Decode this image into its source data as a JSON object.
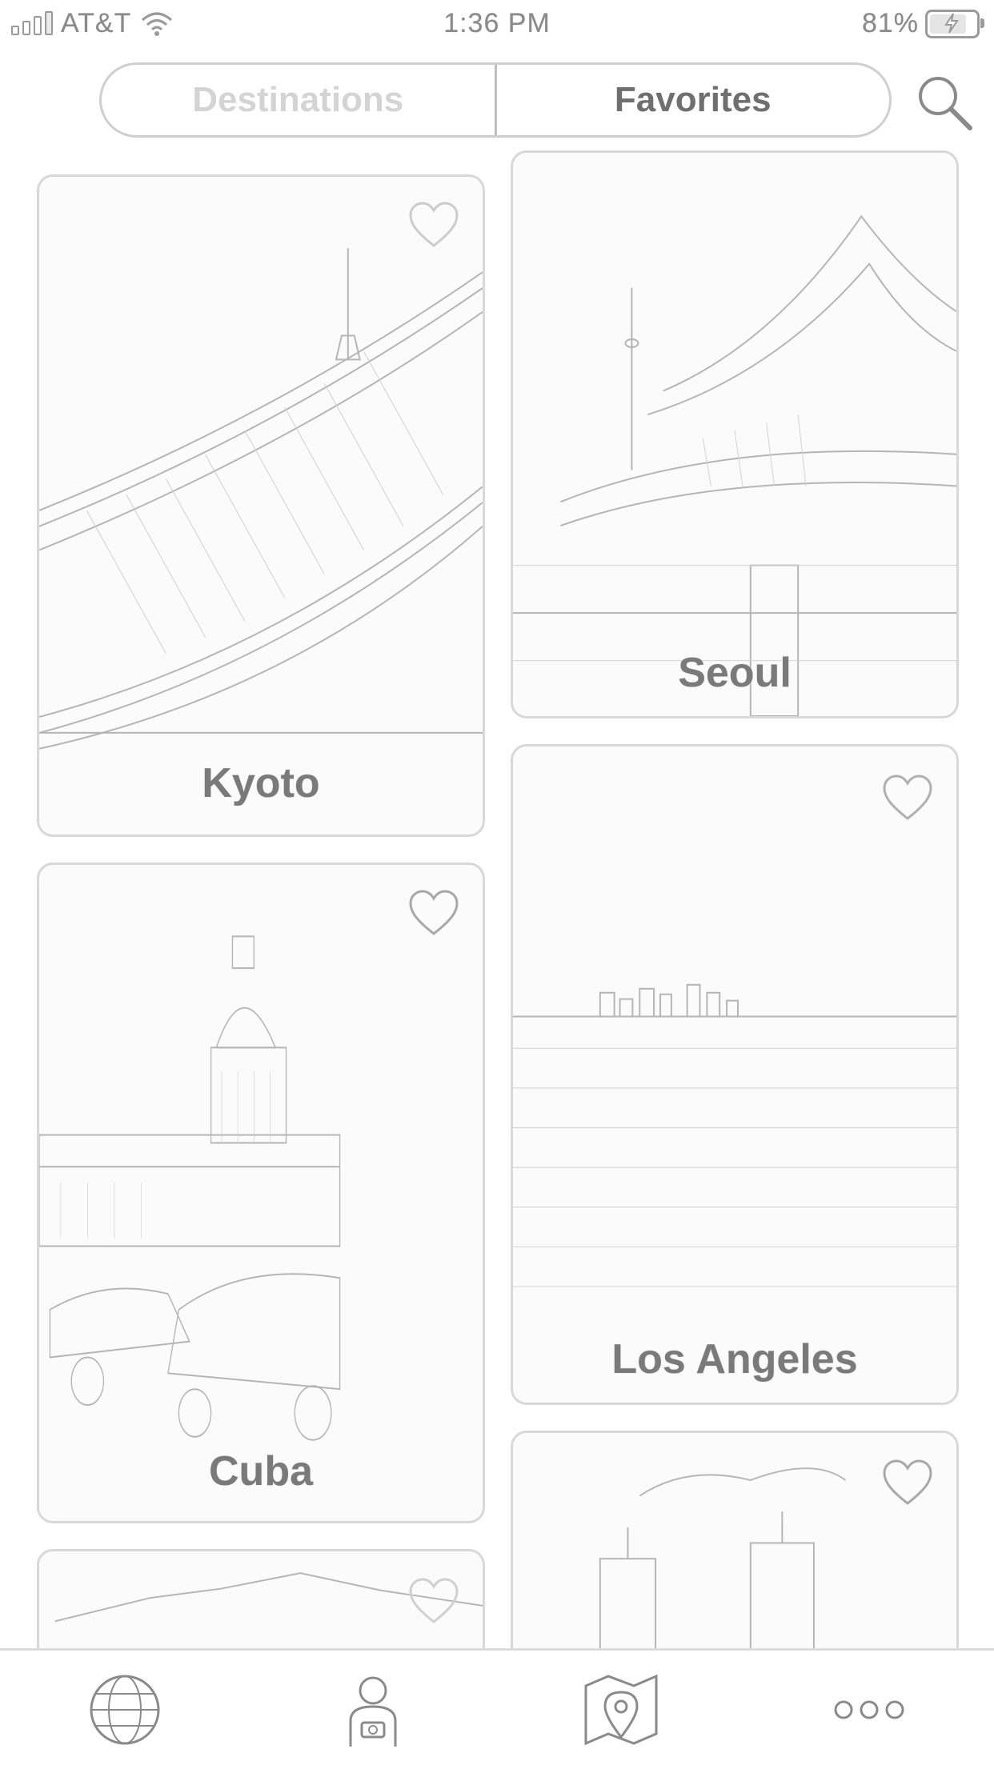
{
  "status_bar": {
    "carrier": "AT&T",
    "time": "1:36 PM",
    "battery_percent": "81%",
    "battery_level": 0.81,
    "icons": [
      "signal-icon",
      "wifi-icon",
      "battery-charging-icon"
    ]
  },
  "segment": {
    "destinations_label": "Destinations",
    "favorites_label": "Favorites",
    "selected": "Favorites"
  },
  "search": {
    "icon": "search-icon"
  },
  "cards": {
    "kyoto": {
      "label": "Kyoto",
      "favorite_icon": "heart-outline-icon"
    },
    "seoul": {
      "label": "Seoul"
    },
    "cuba": {
      "label": "Cuba",
      "favorite_icon": "heart-outline-icon"
    },
    "los_angeles": {
      "label": "Los Angeles",
      "favorite_icon": "heart-outline-icon"
    },
    "partial_left": {
      "favorite_icon": "heart-outline-icon"
    },
    "partial_right": {
      "favorite_icon": "heart-outline-icon"
    }
  },
  "tab_bar": {
    "items": [
      {
        "icon": "globe-icon"
      },
      {
        "icon": "traveler-icon"
      },
      {
        "icon": "map-pin-icon"
      },
      {
        "icon": "more-dots-icon"
      }
    ]
  }
}
